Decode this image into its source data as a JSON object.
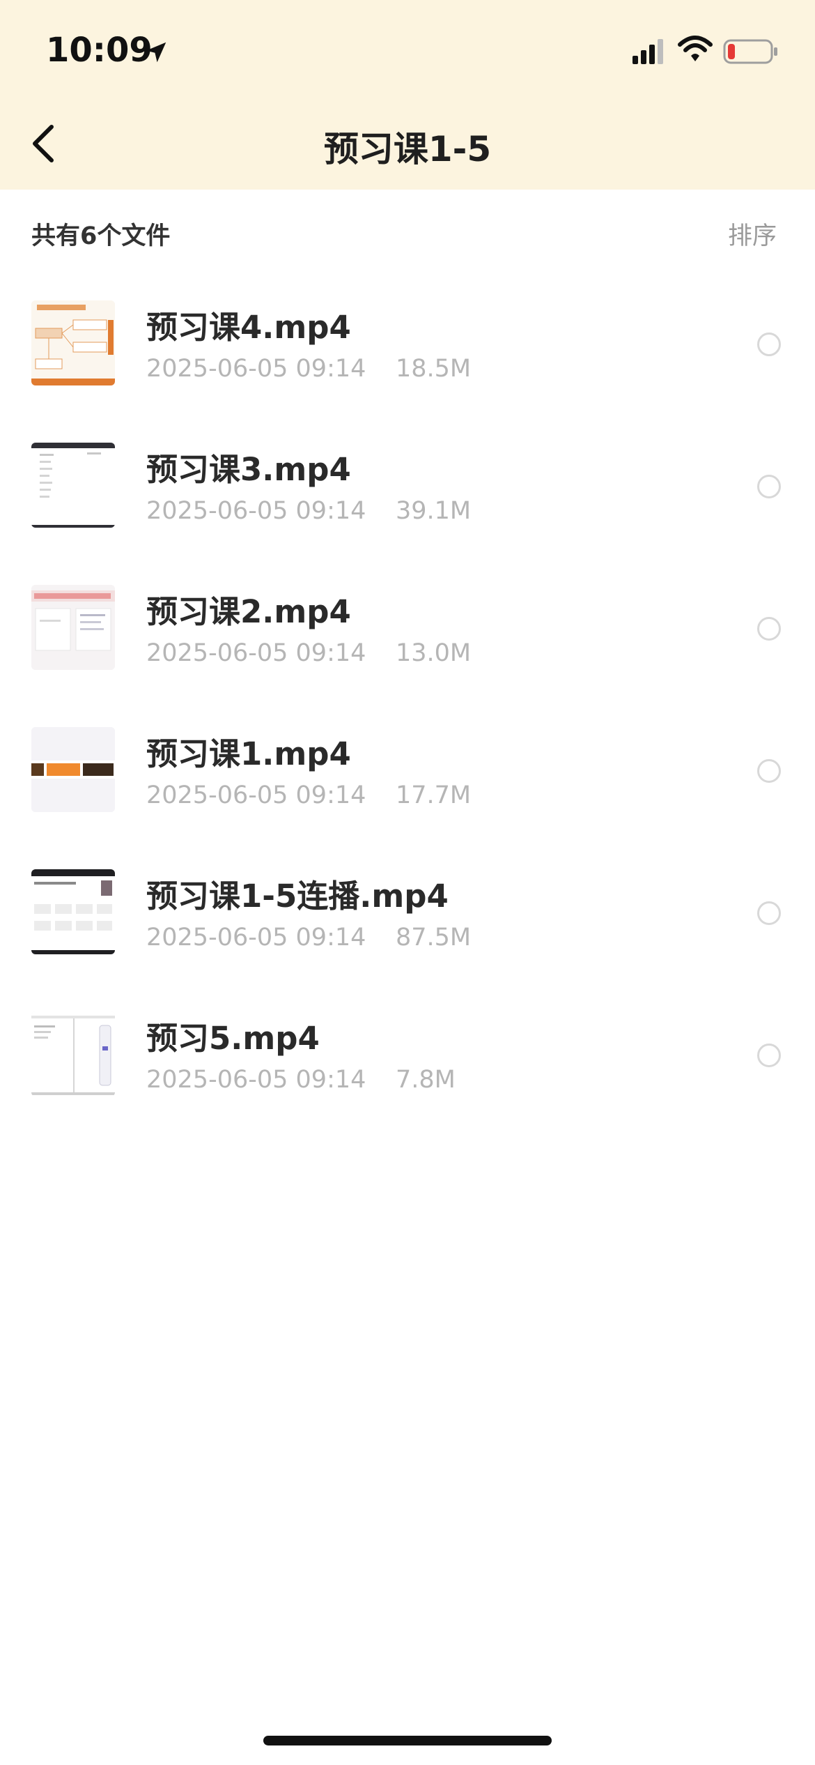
{
  "status_bar": {
    "time": "10:09"
  },
  "header": {
    "title": "预习课1-5"
  },
  "toolbar": {
    "count_label": "共有6个文件",
    "sort_label": "排序"
  },
  "files": [
    {
      "name": "预习课4.mp4",
      "date": "2025-06-05 09:14",
      "size": "18.5M",
      "thumb": "mindmap"
    },
    {
      "name": "预习课3.mp4",
      "date": "2025-06-05 09:14",
      "size": "39.1M",
      "thumb": "doc-dark-header"
    },
    {
      "name": "预习课2.mp4",
      "date": "2025-06-05 09:14",
      "size": "13.0M",
      "thumb": "slide-plugins"
    },
    {
      "name": "预习课1.mp4",
      "date": "2025-06-05 09:14",
      "size": "17.7M",
      "thumb": "slide-title"
    },
    {
      "name": "预习课1-5连播.mp4",
      "date": "2025-06-05 09:14",
      "size": "87.5M",
      "thumb": "grid-dark-header"
    },
    {
      "name": "预习5.mp4",
      "date": "2025-06-05 09:14",
      "size": "7.8M",
      "thumb": "doc-split"
    }
  ],
  "colors": {
    "header_bg": "#fcf4df",
    "meta_text": "#b5b5b5",
    "battery_low": "#e53935"
  }
}
